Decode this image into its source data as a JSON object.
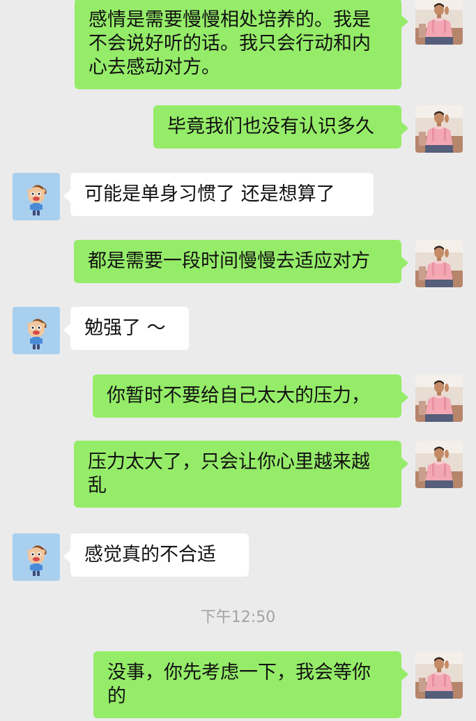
{
  "chat": {
    "messages": [
      {
        "sender": "me",
        "text": "感情是需要慢慢相处培养的。我是不会说好听的话。我只会行动和内心去感动对方。"
      },
      {
        "sender": "me",
        "text": "毕竟我们也没有认识多久"
      },
      {
        "sender": "them",
        "text": "可能是单身习惯了  还是想算了"
      },
      {
        "sender": "me",
        "text": "都是需要一段时间慢慢去适应对方"
      },
      {
        "sender": "them",
        "text": "勉强了  ～"
      },
      {
        "sender": "me",
        "text": "你暂时不要给自己太大的压力，"
      },
      {
        "sender": "me",
        "text": "压力太大了，只会让你心里越来越乱"
      },
      {
        "sender": "them",
        "text": "感觉真的不合适"
      },
      {
        "sender": "me",
        "text": "没事，你先考虑一下，我会等你的"
      }
    ],
    "timestamp": "下午12:50"
  },
  "avatars": {
    "me": "man-in-pink-shirt-photo",
    "them": "cartoon-boy-avatar"
  },
  "colors": {
    "background": "#ebebeb",
    "outgoing_bubble": "#95ec69",
    "incoming_bubble": "#ffffff",
    "timestamp_text": "#a3a3a3"
  }
}
